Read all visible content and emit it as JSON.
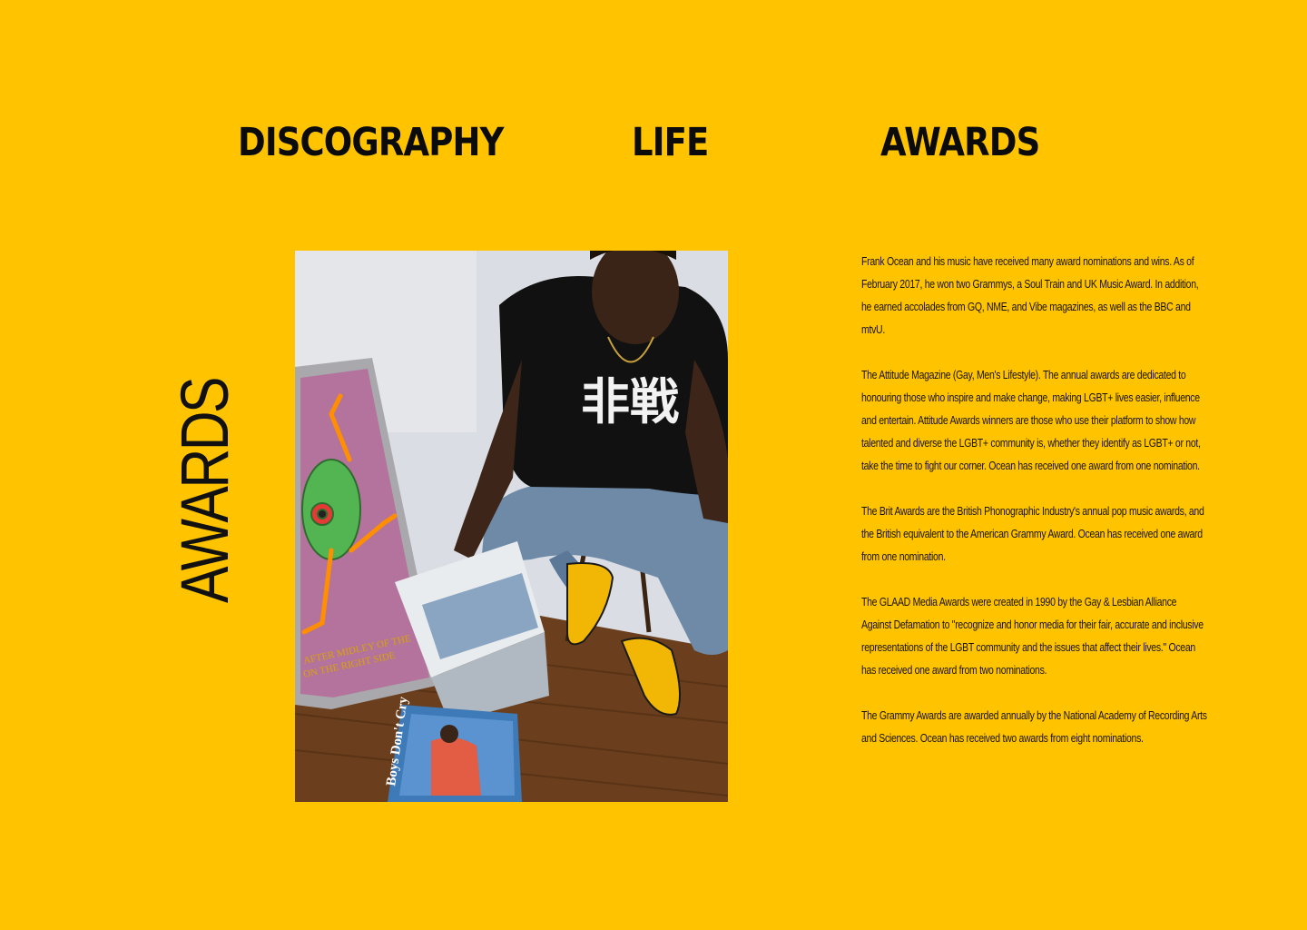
{
  "nav": {
    "items": [
      {
        "label": "DISCOGRAPHY"
      },
      {
        "label": "LIFE"
      },
      {
        "label": "AWARDS"
      }
    ]
  },
  "section_title": "AWARDS",
  "photo": {
    "shirt_text": "非戦",
    "magazine_title": "Boys Don't Cry"
  },
  "paragraphs": [
    "Frank Ocean and his music have received many award nominations and wins. As of February 2017, he won two Grammys, a Soul Train and UK Music Award. In addition, he earned accolades from GQ, NME, and Vibe magazines, as well as the BBC and mtvU.",
    "The Attitude Magazine (Gay, Men's Lifestyle). The annual awards are dedicated to honouring those who inspire and make change, making LGBT+ lives easier, influence and entertain. Attitude Awards winners are those who use their platform to show how talented and diverse the LGBT+ community is, whether they identify as LGBT+ or not, take the time to fight our corner. Ocean has received one award from one nomination.",
    "The Brit Awards are the British Phonographic Industry's annual pop music awards, and the British equivalent to the American Grammy Award. Ocean has received one award from one nomination.",
    "The GLAAD Media Awards were created in 1990 by the Gay & Lesbian Alliance Against Defamation to \"recognize and honor media for their fair, accurate and inclusive representations of the LGBT community and the issues that affect their lives.\" Ocean has received one award from two nominations.",
    "The Grammy Awards are awarded annually by the National Academy of Recording Arts and Sciences. Ocean has received two awards from eight nominations."
  ],
  "colors": {
    "background": "#FFC300",
    "text": "#111111"
  }
}
